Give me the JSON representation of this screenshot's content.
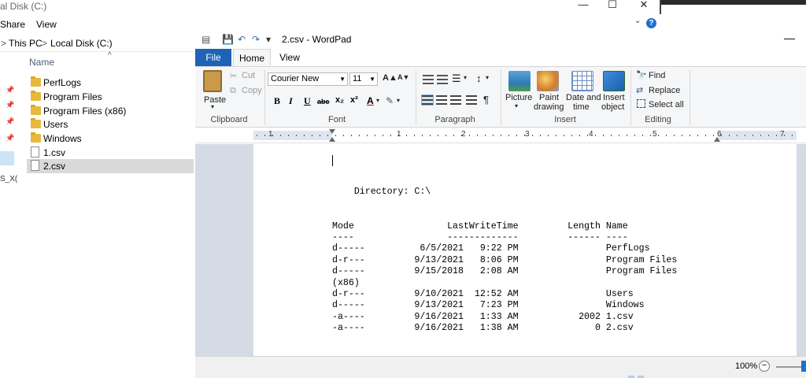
{
  "explorer": {
    "title": "al Disk (C:)",
    "menu": {
      "share": "Share",
      "view": "View"
    },
    "breadcrumb": {
      "this_pc": "This PC",
      "sep": ">",
      "local_disk": "Local Disk (C:)",
      "sep2": ">"
    },
    "window_controls": {
      "minimize": "—",
      "maximize": "☐",
      "close": "✕"
    },
    "column_header": "Name",
    "nav_truncated": "S_X(",
    "help": "?",
    "files": [
      {
        "name": "PerfLogs",
        "type": "folder",
        "selected": false
      },
      {
        "name": "Program Files",
        "type": "folder",
        "selected": false
      },
      {
        "name": "Program Files (x86)",
        "type": "folder",
        "selected": false
      },
      {
        "name": "Users",
        "type": "folder",
        "selected": false
      },
      {
        "name": "Windows",
        "type": "folder",
        "selected": false
      },
      {
        "name": "1.csv",
        "type": "file",
        "selected": false
      },
      {
        "name": "2.csv",
        "type": "file",
        "selected": true
      }
    ]
  },
  "wordpad": {
    "title": "2.csv - WordPad",
    "quick_access": {
      "save": "💾",
      "undo": "↶",
      "redo": "↷",
      "customize": "▾"
    },
    "minimize": "—",
    "tabs": {
      "file": "File",
      "home": "Home",
      "view": "View"
    },
    "clipboard": {
      "paste": "Paste",
      "cut": "Cut",
      "copy": "Copy",
      "label": "Clipboard"
    },
    "font": {
      "family": "Courier New",
      "size": "11",
      "bold": "B",
      "italic": "I",
      "underline": "U",
      "strike": "abc",
      "subscript": "x₂",
      "superscript": "x²",
      "grow": "A▲",
      "shrink": "A▼",
      "color": "A",
      "highlight": "✎",
      "label": "Font"
    },
    "paragraph": {
      "label": "Paragraph"
    },
    "insert": {
      "picture": "Picture",
      "paint": "Paint",
      "paint2": "drawing",
      "datetime": "Date and",
      "datetime2": "time",
      "object": "Insert",
      "object2": "object",
      "label": "Insert"
    },
    "editing": {
      "find": "Find",
      "replace": "Replace",
      "select_all": "Select all",
      "label": "Editing"
    },
    "ruler_numbers": [
      "1",
      "1",
      "2",
      "3",
      "4",
      "5",
      "6",
      "7"
    ],
    "document_text": "\n    Directory: C:\\\n\n\nMode                 LastWriteTime         Length Name\n----                 -------------         ------ ----\nd-----          6/5/2021   9:22 PM                PerfLogs\nd-r---         9/13/2021   8:06 PM                Program Files\nd-----         9/15/2018   2:08 AM                Program Files\n(x86)\nd-r---         9/10/2021  12:52 AM                Users\nd-----         9/13/2021   7:23 PM                Windows\n-a----         9/16/2021   1:33 AM           2002 1.csv\n-a----         9/16/2021   1:38 AM              0 2.csv",
    "zoom": "100%",
    "zoom_minus": "−"
  }
}
